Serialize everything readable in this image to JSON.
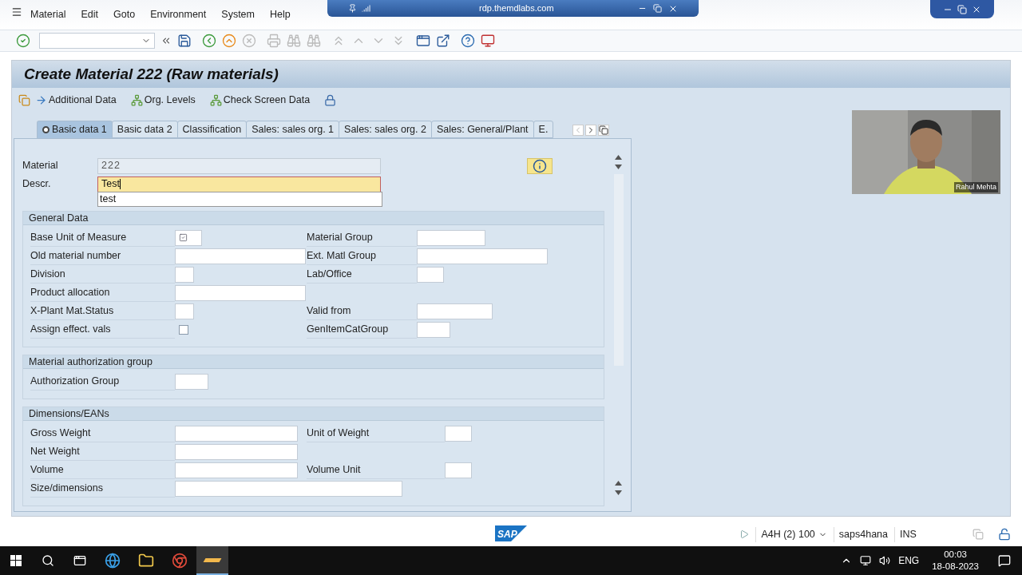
{
  "menu": [
    {
      "label": "Material"
    },
    {
      "label": "Edit"
    },
    {
      "label": "Goto"
    },
    {
      "label": "Environment"
    },
    {
      "label": "System"
    },
    {
      "label": "Help"
    }
  ],
  "remote_bar": {
    "title": "rdp.themdlabs.com"
  },
  "title": "Create Material 222 (Raw materials)",
  "app_toolbar": [
    {
      "label": "Additional Data"
    },
    {
      "label": "Org. Levels"
    },
    {
      "label": "Check Screen Data"
    }
  ],
  "tabs": [
    {
      "label": "Basic data 1",
      "selected": true
    },
    {
      "label": "Basic data 2",
      "selected": false
    },
    {
      "label": "Classification",
      "selected": false
    },
    {
      "label": "Sales: sales org. 1",
      "selected": false
    },
    {
      "label": "Sales: sales org. 2",
      "selected": false
    },
    {
      "label": "Sales: General/Plant",
      "selected": false
    },
    {
      "label": "E.",
      "selected": false
    }
  ],
  "material": {
    "label": "Material",
    "value": "222"
  },
  "description": {
    "label": "Descr.",
    "value": "Test",
    "suggestion": "test"
  },
  "groups": [
    {
      "title": "General Data",
      "rows": [
        {
          "left": {
            "label": "Base Unit of Measure",
            "kind": "required"
          },
          "right": {
            "label": "Material Group",
            "kind": "field"
          }
        },
        {
          "left": {
            "label": "Old material number",
            "kind": "field"
          },
          "right": {
            "label": "Ext. Matl Group",
            "kind": "field"
          }
        },
        {
          "left": {
            "label": "Division",
            "kind": "field"
          },
          "right": {
            "label": "Lab/Office",
            "kind": "field"
          }
        },
        {
          "left": {
            "label": "Product allocation",
            "kind": "field"
          }
        },
        {
          "left": {
            "label": "X-Plant Mat.Status",
            "kind": "field"
          },
          "right": {
            "label": "Valid from",
            "kind": "field"
          }
        },
        {
          "left": {
            "label": "Assign effect. vals",
            "kind": "checkbox",
            "checked": false
          },
          "right": {
            "label": "GenItemCatGroup",
            "kind": "field"
          }
        }
      ]
    },
    {
      "title": "Material authorization group",
      "rows": [
        {
          "left": {
            "label": "Authorization Group",
            "kind": "field"
          }
        }
      ]
    },
    {
      "title": "Dimensions/EANs",
      "rows": [
        {
          "left": {
            "label": "Gross Weight",
            "kind": "field"
          },
          "right": {
            "label": "Unit of Weight",
            "kind": "field"
          }
        },
        {
          "left": {
            "label": "Net Weight",
            "kind": "field"
          }
        },
        {
          "left": {
            "label": "Volume",
            "kind": "field"
          },
          "right": {
            "label": "Volume Unit",
            "kind": "field"
          }
        },
        {
          "left": {
            "label": "Size/dimensions",
            "kind": "field"
          }
        }
      ]
    }
  ],
  "video": {
    "kind": "picture",
    "caption": "Rahul Mehta"
  },
  "logo": "SAP",
  "status_bar": {
    "system": "A4H (2) 100",
    "server": "saps4hana",
    "mode": "INS"
  },
  "taskbar": {
    "language": "ENG",
    "time": "00:03",
    "date": "18-08-2023"
  }
}
